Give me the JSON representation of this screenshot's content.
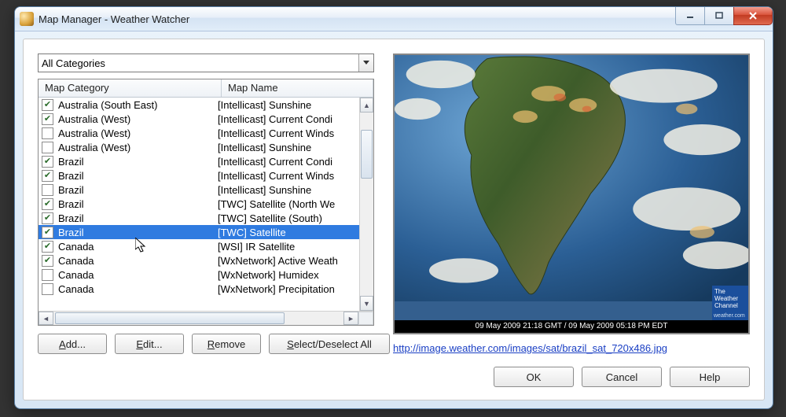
{
  "window": {
    "title": "Map Manager - Weather Watcher"
  },
  "filter": {
    "selected": "All Categories"
  },
  "columns": {
    "category": "Map Category",
    "name": "Map Name"
  },
  "rows": [
    {
      "checked": true,
      "category": "Australia (South East)",
      "name": "[Intellicast] Sunshine"
    },
    {
      "checked": true,
      "category": "Australia (West)",
      "name": "[Intellicast] Current Condi"
    },
    {
      "checked": false,
      "category": "Australia (West)",
      "name": "[Intellicast] Current Winds"
    },
    {
      "checked": false,
      "category": "Australia (West)",
      "name": "[Intellicast] Sunshine"
    },
    {
      "checked": true,
      "category": "Brazil",
      "name": "[Intellicast] Current Condi"
    },
    {
      "checked": true,
      "category": "Brazil",
      "name": "[Intellicast] Current Winds"
    },
    {
      "checked": false,
      "category": "Brazil",
      "name": "[Intellicast] Sunshine"
    },
    {
      "checked": true,
      "category": "Brazil",
      "name": "[TWC] Satellite (North We"
    },
    {
      "checked": true,
      "category": "Brazil",
      "name": "[TWC] Satellite (South)"
    },
    {
      "checked": true,
      "category": "Brazil",
      "name": "[TWC] Satellite",
      "selected": true
    },
    {
      "checked": true,
      "category": "Canada",
      "name": "[WSI] IR Satellite"
    },
    {
      "checked": true,
      "category": "Canada",
      "name": "[WxNetwork] Active Weath"
    },
    {
      "checked": false,
      "category": "Canada",
      "name": "[WxNetwork] Humidex"
    },
    {
      "checked": false,
      "category": "Canada",
      "name": "[WxNetwork] Precipitation"
    }
  ],
  "buttons": {
    "add": "Add...",
    "edit": "Edit...",
    "remove": "Remove",
    "toggle": "Select/Deselect All",
    "ok": "OK",
    "cancel": "Cancel",
    "help": "Help"
  },
  "mnemonics": {
    "add": "A",
    "edit": "E",
    "remove": "R",
    "toggle": "S"
  },
  "preview": {
    "timestamp": "09 May 2009 21:18 GMT / 09 May 2009 05:18 PM EDT",
    "badge_lines": [
      "The",
      "Weather",
      "Channel"
    ],
    "badge_url": "weather.com",
    "link": "http://image.weather.com/images/sat/brazil_sat_720x486.jpg"
  }
}
